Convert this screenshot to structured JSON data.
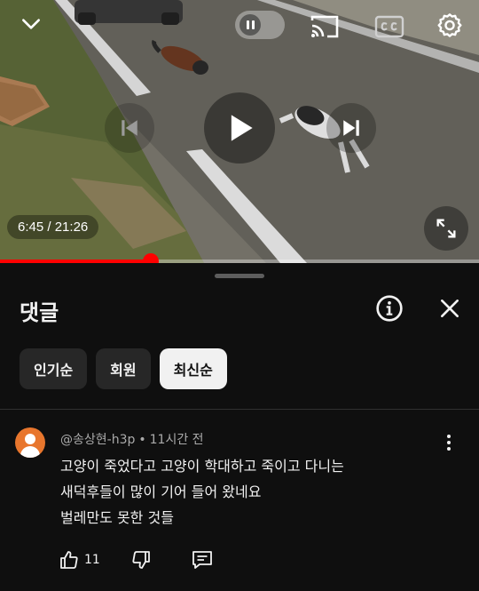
{
  "player": {
    "current_time": "6:45",
    "separator": " / ",
    "duration": "21:26",
    "progress": 0.315,
    "icons": [
      "chevron-down-icon",
      "pause-icon",
      "cast-icon",
      "captions-icon",
      "settings-icon",
      "previous-icon",
      "play-icon",
      "next-icon",
      "fullscreen-icon"
    ],
    "accent_color": "#ff0000"
  },
  "comments_panel": {
    "title": "댓글",
    "filters": [
      {
        "label": "인기순",
        "active": false
      },
      {
        "label": "회원",
        "active": false
      },
      {
        "label": "최신순",
        "active": true
      }
    ],
    "comments": [
      {
        "author": "@송상현-h3p",
        "time_ago": "11시간 전",
        "text_lines": [
          "고양이 죽었다고 고양이 학대하고 죽이고 다니는",
          "새덕후들이 많이 기어 들어 왔네요",
          "벌레만도 못한 것들"
        ],
        "likes": "11",
        "avatar_color": "#e8762d"
      }
    ]
  }
}
